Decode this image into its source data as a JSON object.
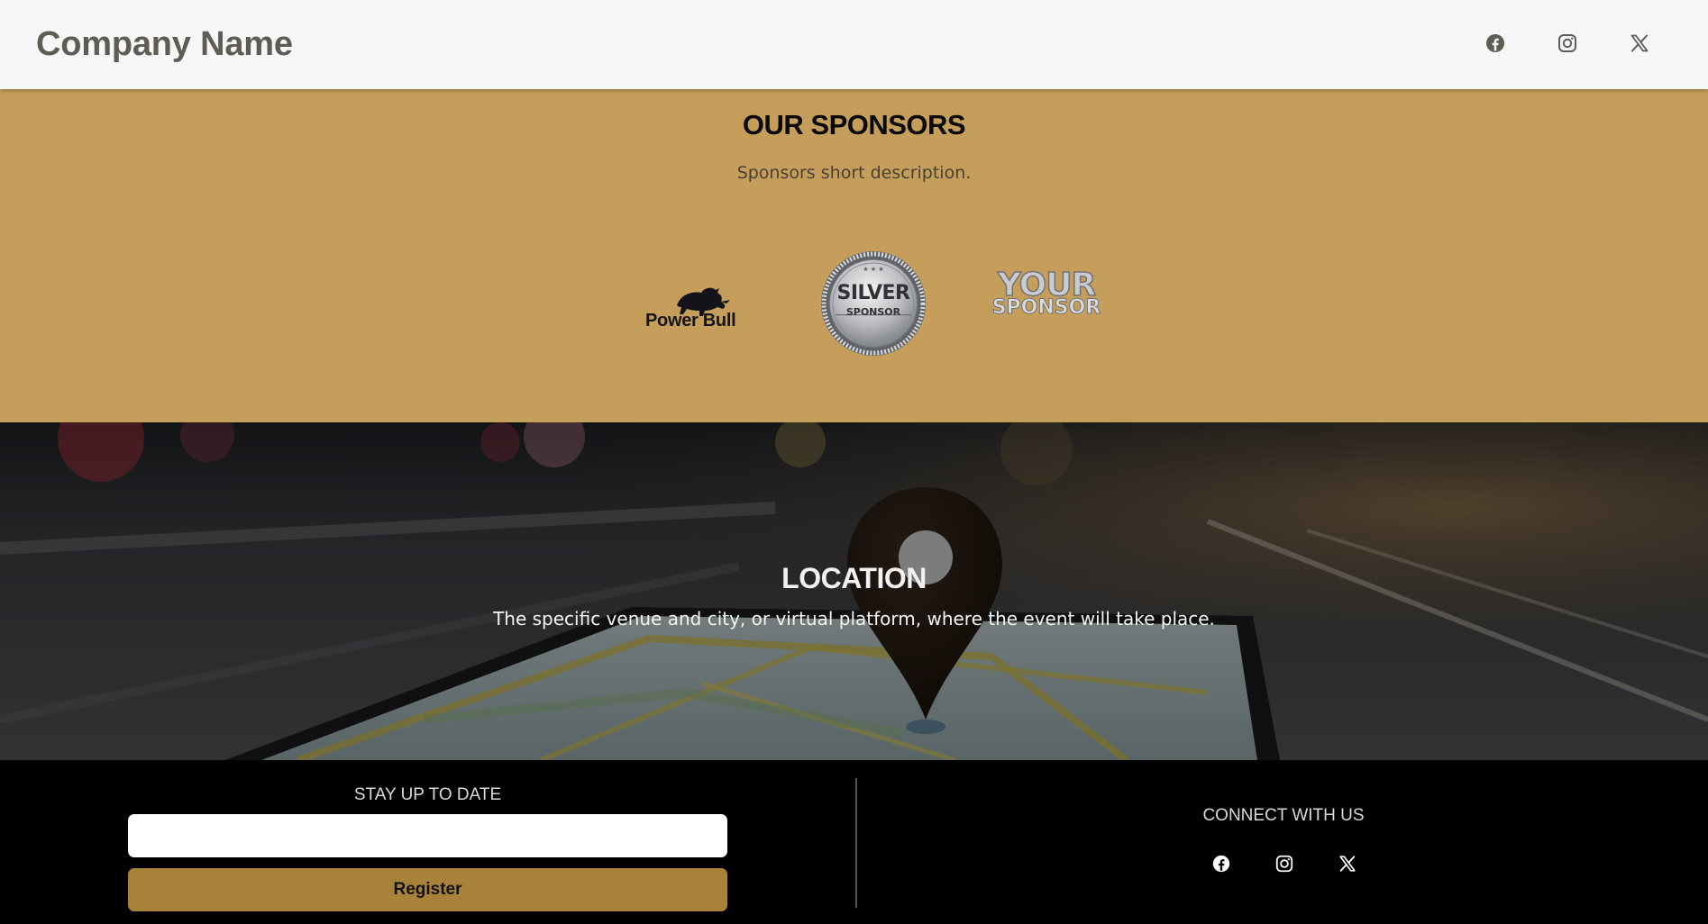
{
  "header": {
    "brand": "Company Name",
    "social": [
      {
        "icon": "facebook-icon"
      },
      {
        "icon": "instagram-icon"
      },
      {
        "icon": "x-twitter-icon"
      }
    ]
  },
  "sponsors": {
    "title": "OUR SPONSORS",
    "description": "Sponsors short description.",
    "logos": [
      {
        "name": "Power Bull",
        "text": "Power Bull"
      },
      {
        "name": "Silver Sponsor",
        "text_top": "SILVER",
        "text_bottom": "SPONSOR"
      },
      {
        "name": "Your Sponsor",
        "text_top": "YOUR",
        "text_bottom": "SPONSOR"
      }
    ]
  },
  "location": {
    "title": "LOCATION",
    "description": "The specific venue and city, or virtual platform, where the event will take place."
  },
  "footer": {
    "stay_label": "STAY UP TO DATE",
    "email_value": "",
    "register_label": "Register",
    "connect_label": "CONNECT WITH US",
    "social": [
      {
        "icon": "facebook-icon"
      },
      {
        "icon": "instagram-icon"
      },
      {
        "icon": "x-twitter-icon"
      }
    ]
  },
  "colors": {
    "header_bg": "#f7f7f7",
    "sponsors_bg": "#c59e5c",
    "footer_bg": "#000000",
    "register_button": "#a98239"
  }
}
